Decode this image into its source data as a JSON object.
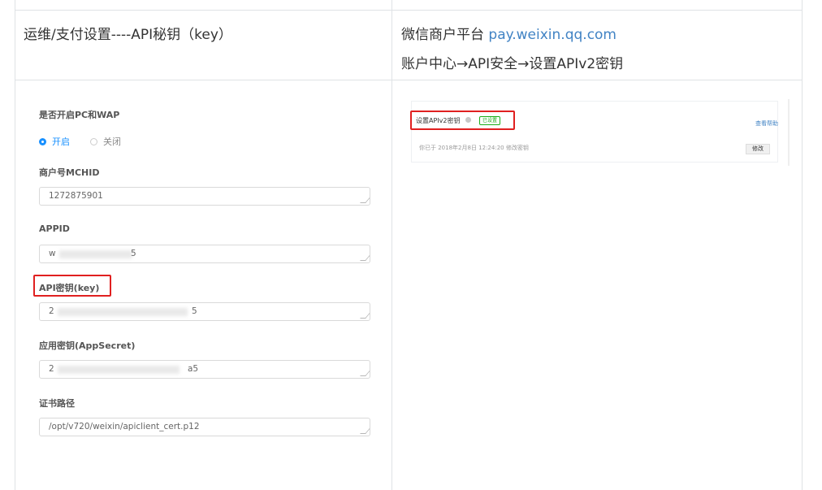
{
  "header": {
    "left_text": "运维/支付设置----API秘钥（key）",
    "right_prefix": "微信商户平台 ",
    "right_link": "pay.weixin.qq.com",
    "right_path": "账户中心→API安全→设置APIv2密钥"
  },
  "form": {
    "enable_label": "是否开启PC和WAP",
    "radio_on": "开启",
    "radio_off": "关闭",
    "mchid_label": "商户号MCHID",
    "mchid_value": "1272875901",
    "appid_label": "APPID",
    "appid_prefix": "w",
    "appid_suffix": "5",
    "apikey_label": "API密钥(key)",
    "apikey_prefix": "2",
    "apikey_suffix": "5",
    "appsecret_label": "应用密钥(AppSecret)",
    "appsecret_prefix": "2",
    "appsecret_suffix": "a5",
    "cert_label": "证书路径",
    "cert_value": "/opt/v720/weixin/apiclient_cert.p12"
  },
  "wechat_panel": {
    "title": "设置APIv2密钥",
    "badge": "已设置",
    "subtitle": "你已于 2018年2月8日 12:24:20 修改密钥",
    "edit_button": "修改",
    "side_link": "查看帮助"
  },
  "colors": {
    "highlight": "#e02020",
    "link": "#4183c4",
    "radio_active": "#1890ff",
    "badge_green": "#1aad19"
  }
}
